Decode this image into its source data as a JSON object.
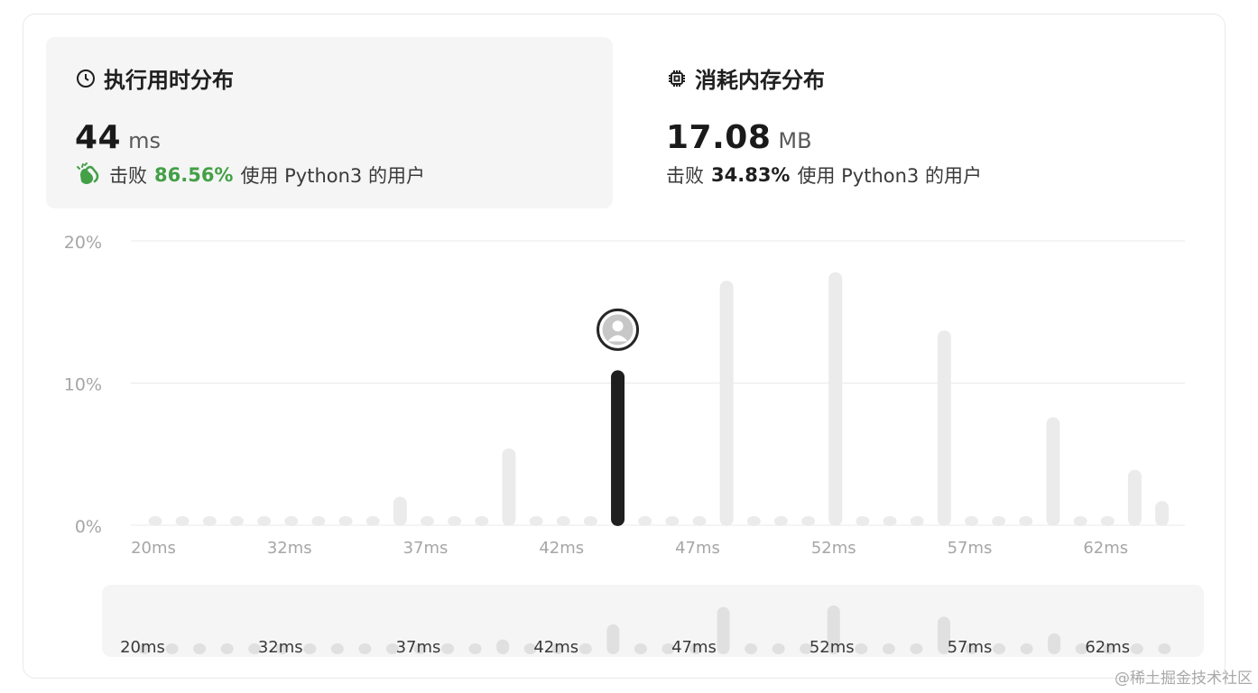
{
  "runtime": {
    "title": "执行用时分布",
    "value": "44",
    "unit": "ms",
    "beats_prefix": "击败",
    "beats_pct": "86.56%",
    "beats_suffix": "使用 Python3 的用户",
    "icon": "clock-icon"
  },
  "memory": {
    "title": "消耗内存分布",
    "value": "17.08",
    "unit": "MB",
    "beats_prefix": "击败",
    "beats_pct": "34.83%",
    "beats_suffix": "使用 Python3 的用户",
    "icon": "chip-icon"
  },
  "colors": {
    "accent_green": "#43a047",
    "bar_gray": "#ebebeb",
    "bar_active": "#1f1f1f",
    "grid": "#e8e8e8"
  },
  "chart_data": {
    "type": "bar",
    "title": "",
    "xlabel": "",
    "ylabel": "",
    "ylim": [
      0,
      20
    ],
    "y_ticks": [
      "0%",
      "10%",
      "20%"
    ],
    "x_tick_labels": [
      "20ms",
      "32ms",
      "37ms",
      "42ms",
      "47ms",
      "52ms",
      "57ms",
      "62ms"
    ],
    "values": [
      0.3,
      0.3,
      0.3,
      0.3,
      0.3,
      0.3,
      0.3,
      0.3,
      0.3,
      2.0,
      0.3,
      0.3,
      0.3,
      5.4,
      0.3,
      0.3,
      0.5,
      10.9,
      0.3,
      0.5,
      0.3,
      17.2,
      0.5,
      0.4,
      0.4,
      17.8,
      0.3,
      0.3,
      0.3,
      13.7,
      0.3,
      0.3,
      0.3,
      7.6,
      0.3,
      0.3,
      3.9,
      1.7
    ],
    "highlight_index": 17,
    "highlight_avatar": "user-avatar-icon",
    "grid": true
  },
  "watermark": "@稀土掘金技术社区"
}
